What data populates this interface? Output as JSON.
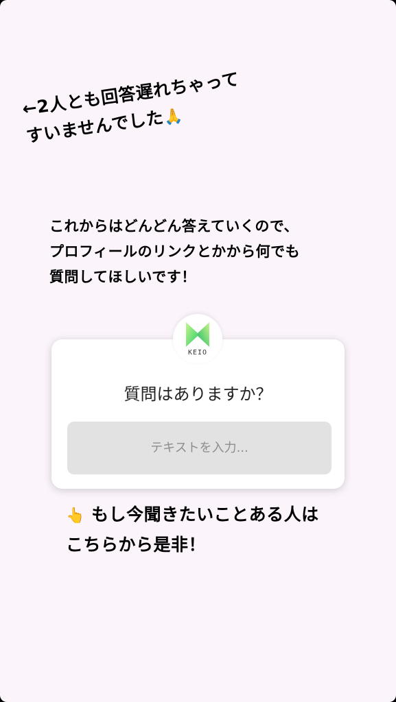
{
  "story": {
    "apology": {
      "line1": "←2人とも回答遅れちゃって",
      "line2": "すいませんでした",
      "emoji": "🙏"
    },
    "message": {
      "line1": "これからはどんどん答えていくので、",
      "line2": "プロフィールのリンクとかから何でも",
      "line3": "質問してほしいです！"
    },
    "question_sticker": {
      "avatar_text": "KEIO",
      "prompt": "質問はありますか？",
      "input_placeholder": "テキストを入力..."
    },
    "cta": {
      "emoji": "👆",
      "line1": "もし今聞きたいことある人は",
      "line2": "こちらから是非！"
    }
  },
  "colors": {
    "background": "#fbf5fb",
    "logo_green_light": "#b6f07a",
    "logo_green_dark": "#22c46a",
    "input_bg": "#e2e2e2"
  }
}
